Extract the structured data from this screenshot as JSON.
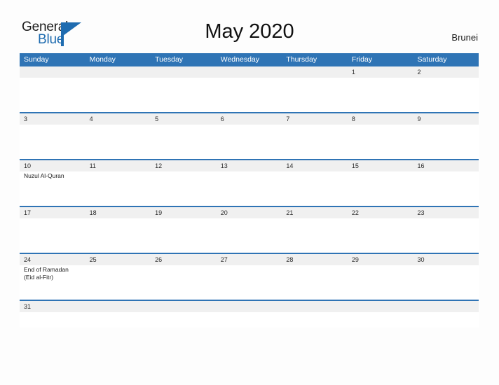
{
  "brand": {
    "name_part1": "General",
    "name_part2": "Blue",
    "triangle_icon": "flag-triangle-icon",
    "color_primary": "#1f6cb0",
    "color_text": "#1a1a1a"
  },
  "header": {
    "title": "May 2020",
    "region": "Brunei"
  },
  "calendar": {
    "header_color": "#2f74b5",
    "number_band_color": "#f0f0f0",
    "day_names": [
      "Sunday",
      "Monday",
      "Tuesday",
      "Wednesday",
      "Thursday",
      "Friday",
      "Saturday"
    ],
    "weeks": [
      {
        "days": [
          {
            "num": "",
            "events": []
          },
          {
            "num": "",
            "events": []
          },
          {
            "num": "",
            "events": []
          },
          {
            "num": "",
            "events": []
          },
          {
            "num": "",
            "events": []
          },
          {
            "num": "1",
            "events": []
          },
          {
            "num": "2",
            "events": []
          }
        ]
      },
      {
        "days": [
          {
            "num": "3",
            "events": []
          },
          {
            "num": "4",
            "events": []
          },
          {
            "num": "5",
            "events": []
          },
          {
            "num": "6",
            "events": []
          },
          {
            "num": "7",
            "events": []
          },
          {
            "num": "8",
            "events": []
          },
          {
            "num": "9",
            "events": []
          }
        ]
      },
      {
        "days": [
          {
            "num": "10",
            "events": [
              "Nuzul Al-Quran"
            ]
          },
          {
            "num": "11",
            "events": []
          },
          {
            "num": "12",
            "events": []
          },
          {
            "num": "13",
            "events": []
          },
          {
            "num": "14",
            "events": []
          },
          {
            "num": "15",
            "events": []
          },
          {
            "num": "16",
            "events": []
          }
        ]
      },
      {
        "days": [
          {
            "num": "17",
            "events": []
          },
          {
            "num": "18",
            "events": []
          },
          {
            "num": "19",
            "events": []
          },
          {
            "num": "20",
            "events": []
          },
          {
            "num": "21",
            "events": []
          },
          {
            "num": "22",
            "events": []
          },
          {
            "num": "23",
            "events": []
          }
        ]
      },
      {
        "days": [
          {
            "num": "24",
            "events": [
              "End of Ramadan",
              "(Eid al-Fitr)"
            ]
          },
          {
            "num": "25",
            "events": []
          },
          {
            "num": "26",
            "events": []
          },
          {
            "num": "27",
            "events": []
          },
          {
            "num": "28",
            "events": []
          },
          {
            "num": "29",
            "events": []
          },
          {
            "num": "30",
            "events": []
          }
        ]
      },
      {
        "short": true,
        "days": [
          {
            "num": "31",
            "events": []
          },
          {
            "num": "",
            "events": []
          },
          {
            "num": "",
            "events": []
          },
          {
            "num": "",
            "events": []
          },
          {
            "num": "",
            "events": []
          },
          {
            "num": "",
            "events": []
          },
          {
            "num": "",
            "events": []
          }
        ]
      }
    ]
  }
}
